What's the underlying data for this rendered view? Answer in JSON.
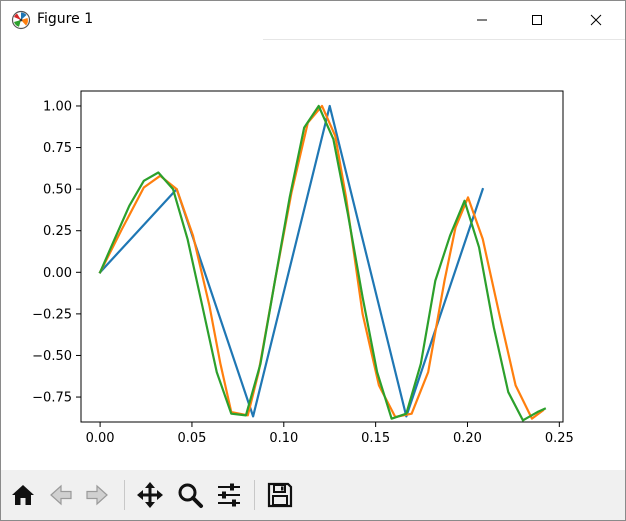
{
  "window": {
    "title": "Figure 1",
    "icon": "matplotlib-logo-icon"
  },
  "toolbar": {
    "buttons": [
      {
        "name": "home",
        "icon": "home-icon"
      },
      {
        "name": "back",
        "icon": "arrow-left-icon"
      },
      {
        "name": "forward",
        "icon": "arrow-right-icon"
      },
      {
        "name": "pan",
        "icon": "move-icon"
      },
      {
        "name": "zoom",
        "icon": "magnifier-icon"
      },
      {
        "name": "configure-subplots",
        "icon": "sliders-icon"
      },
      {
        "name": "save",
        "icon": "floppy-disk-icon"
      }
    ]
  },
  "chart_data": {
    "type": "line",
    "title": "",
    "xlabel": "",
    "ylabel": "",
    "xlim": [
      -0.0104,
      0.252
    ],
    "ylim": [
      -0.9,
      1.09
    ],
    "xticks": [
      0.0,
      0.05,
      0.1,
      0.15,
      0.2,
      0.25
    ],
    "xtick_labels": [
      "0.00",
      "0.05",
      "0.10",
      "0.15",
      "0.20",
      "0.25"
    ],
    "yticks": [
      -0.75,
      -0.5,
      -0.25,
      0.0,
      0.25,
      0.5,
      0.75,
      1.0
    ],
    "ytick_labels": [
      "−0.75",
      "−0.50",
      "−0.25",
      "0.00",
      "0.25",
      "0.50",
      "0.75",
      "1.00"
    ],
    "grid": false,
    "legend": "none",
    "series": [
      {
        "color": "#1f77b4",
        "points": [
          [
            0.0,
            0.0
          ],
          [
            0.0417,
            0.5
          ],
          [
            0.0833,
            -0.866
          ],
          [
            0.125,
            1.0
          ],
          [
            0.1667,
            -0.866
          ],
          [
            0.2083,
            0.5
          ]
        ]
      },
      {
        "color": "#ff7f0e",
        "points": [
          [
            0.0,
            0.0
          ],
          [
            0.0119,
            0.26
          ],
          [
            0.0238,
            0.51
          ],
          [
            0.0327,
            0.58
          ],
          [
            0.0417,
            0.5
          ],
          [
            0.0506,
            0.22
          ],
          [
            0.0595,
            -0.2
          ],
          [
            0.0655,
            -0.55
          ],
          [
            0.0714,
            -0.84
          ],
          [
            0.0804,
            -0.86
          ],
          [
            0.0863,
            -0.6
          ],
          [
            0.0952,
            -0.05
          ],
          [
            0.1042,
            0.48
          ],
          [
            0.1131,
            0.9
          ],
          [
            0.1208,
            1.0
          ],
          [
            0.128,
            0.82
          ],
          [
            0.1339,
            0.45
          ],
          [
            0.1429,
            -0.25
          ],
          [
            0.1518,
            -0.68
          ],
          [
            0.1607,
            -0.87
          ],
          [
            0.1696,
            -0.85
          ],
          [
            0.1786,
            -0.6
          ],
          [
            0.1875,
            -0.05
          ],
          [
            0.1935,
            0.27
          ],
          [
            0.2003,
            0.45
          ],
          [
            0.2083,
            0.2
          ],
          [
            0.2173,
            -0.25
          ],
          [
            0.2262,
            -0.68
          ],
          [
            0.2351,
            -0.88
          ],
          [
            0.2411,
            -0.83
          ]
        ]
      },
      {
        "color": "#2ca02c",
        "points": [
          [
            0.0,
            0.0
          ],
          [
            0.0079,
            0.2
          ],
          [
            0.0159,
            0.4
          ],
          [
            0.0238,
            0.55
          ],
          [
            0.0317,
            0.6
          ],
          [
            0.0397,
            0.5
          ],
          [
            0.0476,
            0.2
          ],
          [
            0.0556,
            -0.2
          ],
          [
            0.0635,
            -0.6
          ],
          [
            0.0714,
            -0.85
          ],
          [
            0.0794,
            -0.86
          ],
          [
            0.0873,
            -0.55
          ],
          [
            0.0952,
            -0.05
          ],
          [
            0.1032,
            0.45
          ],
          [
            0.1111,
            0.87
          ],
          [
            0.119,
            1.0
          ],
          [
            0.127,
            0.8
          ],
          [
            0.1349,
            0.35
          ],
          [
            0.1429,
            -0.15
          ],
          [
            0.1508,
            -0.6
          ],
          [
            0.1587,
            -0.88
          ],
          [
            0.1667,
            -0.85
          ],
          [
            0.1746,
            -0.55
          ],
          [
            0.1825,
            -0.05
          ],
          [
            0.1905,
            0.22
          ],
          [
            0.1984,
            0.43
          ],
          [
            0.2063,
            0.15
          ],
          [
            0.2143,
            -0.33
          ],
          [
            0.2222,
            -0.72
          ],
          [
            0.2302,
            -0.89
          ],
          [
            0.2381,
            -0.84
          ],
          [
            0.2421,
            -0.82
          ]
        ]
      }
    ]
  }
}
